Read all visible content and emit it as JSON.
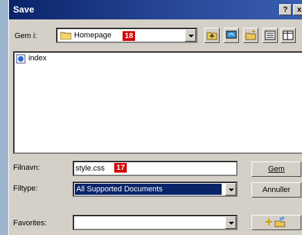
{
  "window": {
    "title": "Save",
    "help_label": "?",
    "close_label": "x"
  },
  "lookin": {
    "label": "Gem i:",
    "folder": "Homepage",
    "badge": "18"
  },
  "files": [
    {
      "name": "index"
    }
  ],
  "filename": {
    "label": "Filnavn:",
    "value": "style.css",
    "badge": "17"
  },
  "filetype": {
    "label": "Filtype:",
    "value": "All Supported Documents"
  },
  "favorites": {
    "label": "Favorites:",
    "value": ""
  },
  "buttons": {
    "save": "Gem",
    "cancel": "Annuller"
  },
  "colors": {
    "title_bar": "#0a246a",
    "selection": "#0a246a",
    "badge": "#d40000",
    "dialog_bg": "#d4d0c8"
  }
}
